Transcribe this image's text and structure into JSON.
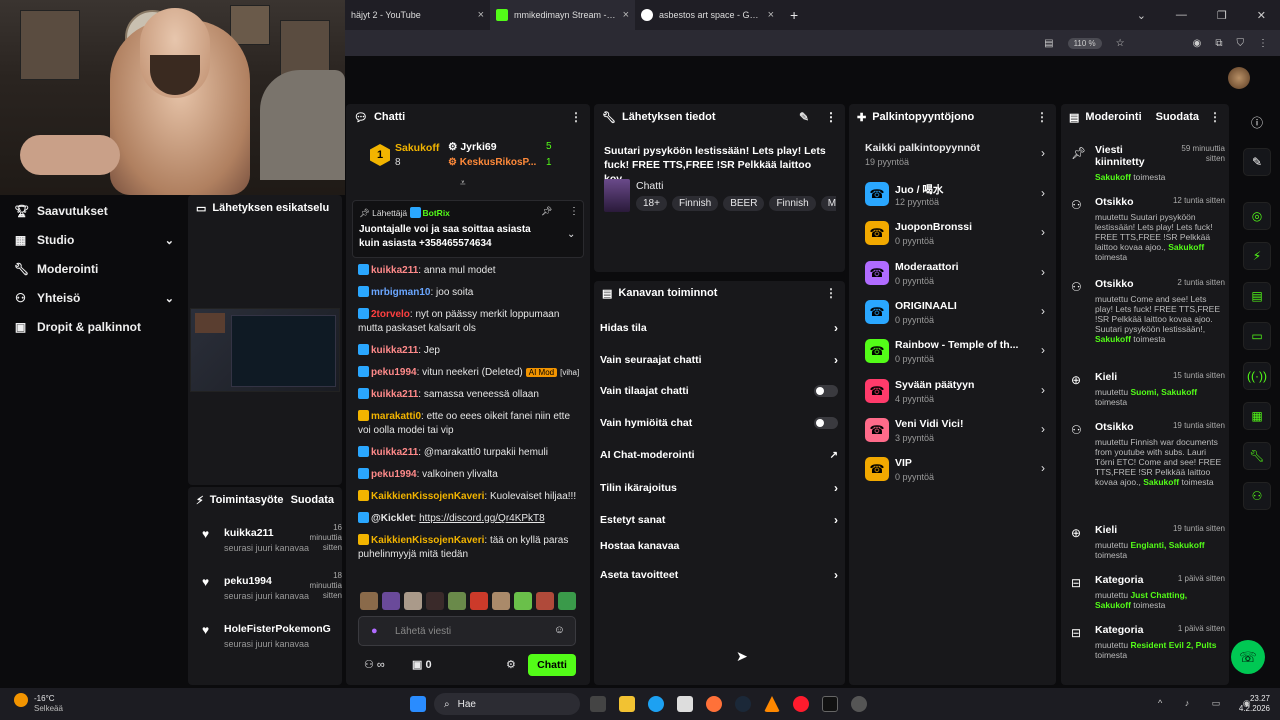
{
  "browser": {
    "tabs": [
      {
        "title": "häjyt 2 - YouTube",
        "icon": "youtube-icon",
        "color": "#1f1e25"
      },
      {
        "title": "mmikedimayn Stream - Watch L",
        "icon": "kick-icon",
        "color": "#2b2a33"
      },
      {
        "title": "asbestos art space - Google-ha",
        "icon": "google-icon",
        "color": "#1f1e25"
      }
    ],
    "zoom": "110 %",
    "new_tab": "+"
  },
  "nav": {
    "items": [
      {
        "label": "Saavutukset",
        "icon": "trophy-icon"
      },
      {
        "label": "Studio",
        "icon": "studio-icon",
        "expand": "⌄"
      },
      {
        "label": "Moderointi",
        "icon": "wrench-icon"
      },
      {
        "label": "Yhteisö",
        "icon": "community-icon",
        "expand": "⌄"
      },
      {
        "label": "Dropit & palkinnot",
        "icon": "gift-icon"
      }
    ]
  },
  "preview": {
    "title": "Lähetyksen esikatselu"
  },
  "activity": {
    "title": "Toimintasyöte",
    "filter": "Suodata",
    "items": [
      {
        "name": "kuikka211",
        "time": "16 minuuttia sitten",
        "sub": "seurasi juuri kanavaa"
      },
      {
        "name": "peku1994",
        "time": "18 minuuttia sitten",
        "sub": "seurasi juuri kanavaa"
      },
      {
        "name": "HoleFisterPokemonG",
        "time": "",
        "sub": "seurasi juuri kanavaa"
      }
    ]
  },
  "chat": {
    "title": "Chatti",
    "leaders": [
      {
        "rank": "1",
        "name": "Sakukoff",
        "count": "8",
        "color": "#f2b400"
      },
      {
        "name": "Jyrki69",
        "count": "5"
      },
      {
        "name": "KeskusRikosP...",
        "count": "1"
      }
    ],
    "pinned": {
      "by": "Lähettäjä",
      "user": "BotRix",
      "text": "Juontajalle voi ja saa soittaa asiasta kuin asiasta +358465574634"
    },
    "messages": [
      {
        "user": "kuikka211",
        "color": "#ff8a8a",
        "text": "anna mul modet"
      },
      {
        "user": "mrbigman10",
        "color": "#6aa6ff",
        "text": "joo soita"
      },
      {
        "user": "2torvelo",
        "color": "#ff4040",
        "text": "nyt on päässy merkit loppumaan mutta paskaset kalsarit ols"
      },
      {
        "user": "kuikka211",
        "color": "#ff8a8a",
        "text": "Jep"
      },
      {
        "user": "peku1994",
        "color": "#ff8a8a",
        "text": "vitun neekeri (Deleted)",
        "tag": "AI Mod",
        "tag2": "[viha]"
      },
      {
        "user": "kuikka211",
        "color": "#ff8a8a",
        "text": "samassa veneessä ollaan"
      },
      {
        "user": "marakatti0",
        "color": "#f2b400",
        "text": "ette oo eees oikeit fanei niin ette voi oolla modei tai vip"
      },
      {
        "user": "kuikka211",
        "color": "#ff8a8a",
        "text": "@marakatti0 turpakii hemuli"
      },
      {
        "user": "peku1994",
        "color": "#ff8a8a",
        "text": "valkoinen ylivalta"
      },
      {
        "user": "KaikkienKissojenKaveri",
        "color": "#f2b400",
        "text": "Kuolevaiset hiljaa!!!"
      },
      {
        "user": "@Kicklet",
        "color": "#e6e6e6",
        "text": "https://discord.gg/Qr4KPkT8"
      },
      {
        "user": "KaikkienKissojenKaveri",
        "color": "#f2b400",
        "text": "tää on kyllä paras puhelinmyyjä mitä tiedän"
      }
    ],
    "input_placeholder": "Lähetä viesti",
    "count": "0",
    "send": "Chatti"
  },
  "info": {
    "title": "Lähetyksen tiedot",
    "stream_title": "Suutari pysyköön lestissään! Lets play! Lets fuck! FREE TTS,FREE !SR Pelkkää laittoo kov...",
    "category": "Chatti",
    "tags": [
      "18+",
      "Finnish",
      "BEER",
      "Finnish",
      "Mo"
    ]
  },
  "actions": {
    "title": "Kanavan toiminnot",
    "items": [
      {
        "label": "Hidas tila",
        "kind": "arrow"
      },
      {
        "label": "Vain seuraajat chatti",
        "kind": "arrow"
      },
      {
        "label": "Vain tilaajat chatti",
        "kind": "toggle"
      },
      {
        "label": "Vain hymiöitä chat",
        "kind": "toggle"
      },
      {
        "label": "AI Chat-moderointi",
        "kind": "ext"
      },
      {
        "label": "Tilin ikärajoitus",
        "kind": "arrow"
      },
      {
        "label": "Estetyt sanat",
        "kind": "arrow"
      },
      {
        "label": "Hostaa kanavaa",
        "kind": "none"
      },
      {
        "label": "Aseta tavoitteet",
        "kind": "arrow"
      }
    ]
  },
  "rewards": {
    "title": "Palkintopyyntöjono",
    "all": "Kaikki palkintopyynnöt",
    "all_count": "19 pyyntöä",
    "items": [
      {
        "name": "Juo / 喝水",
        "count": "12 pyyntöä",
        "color": "#2aa7ff"
      },
      {
        "name": "JuoponBronssi",
        "count": "0 pyyntöä",
        "color": "#f2a900"
      },
      {
        "name": "Moderaattori",
        "count": "0 pyyntöä",
        "color": "#b06bff"
      },
      {
        "name": "ORIGINAALI",
        "count": "0 pyyntöä",
        "color": "#2aa7ff"
      },
      {
        "name": "Rainbow - Temple of th...",
        "count": "0 pyyntöä",
        "color": "#53fc18"
      },
      {
        "name": "Syvään päätyyn",
        "count": "4 pyyntöä",
        "color": "#ff3b6b"
      },
      {
        "name": "Veni Vidi Vici!",
        "count": "3 pyyntöä",
        "color": "#ff6b8a"
      },
      {
        "name": "VIP",
        "count": "0 pyyntöä",
        "color": "#f2a900"
      }
    ]
  },
  "moderation": {
    "title": "Moderointi",
    "filter": "Suodata",
    "items": [
      {
        "title": "Viesti kiinnitetty",
        "time": "59 minuuttia sitten",
        "desc": "",
        "who": "Sakukoff",
        "tail": "toimesta",
        "icon": "pin-icon"
      },
      {
        "title": "Otsikko",
        "time": "12 tuntia sitten",
        "desc": "muutettu Suutari pysyköön lestissään! Lets play! Lets fuck! FREE TTS,FREE !SR Pelkkää laittoo kovaa ajoo.,",
        "who": "Sakukoff",
        "tail": "toimesta",
        "icon": "people-icon"
      },
      {
        "title": "Otsikko",
        "time": "2 tuntia sitten",
        "desc": "muutettu Come and see! Lets play! Lets fuck! FREE TTS,FREE !SR Pelkkää laittoo kovaa ajoo. Suutari pysyköön lestissään!,",
        "who": "Sakukoff",
        "tail": "toimesta",
        "icon": "people-icon"
      },
      {
        "title": "Kieli",
        "time": "15 tuntia sitten",
        "desc": "muutettu",
        "hl": "Suomi, Sakukoff",
        "tail": "toimesta",
        "icon": "globe-icon"
      },
      {
        "title": "Otsikko",
        "time": "19 tuntia sitten",
        "desc": "muutettu Finnish war documents from youtube with subs. Lauri Törni ETC! Come and see! FREE TTS,FREE !SR Pelkkää laittoo kovaa ajoo.,",
        "who": "Sakukoff",
        "tail": "toimesta",
        "icon": "people-icon"
      },
      {
        "title": "Kieli",
        "time": "19 tuntia sitten",
        "desc": "muutettu",
        "hl": "Englanti, Sakukoff",
        "tail": "toimesta",
        "icon": "globe-icon"
      },
      {
        "title": "Kategoria",
        "time": "1 päivä sitten",
        "desc": "muutettu",
        "hl": "Just Chatting, Sakukoff",
        "tail": "toimesta",
        "icon": "category-icon"
      },
      {
        "title": "Kategoria",
        "time": "1 päivä sitten",
        "desc": "muutettu",
        "hl": "Resident Evil 2, Pults",
        "tail": "toimesta",
        "icon": "category-icon"
      }
    ]
  },
  "taskbar": {
    "weather": "-16°C",
    "weather_sub": "Selkeää",
    "search": "Hae",
    "time": "23.27",
    "date": "4.2.2026"
  }
}
